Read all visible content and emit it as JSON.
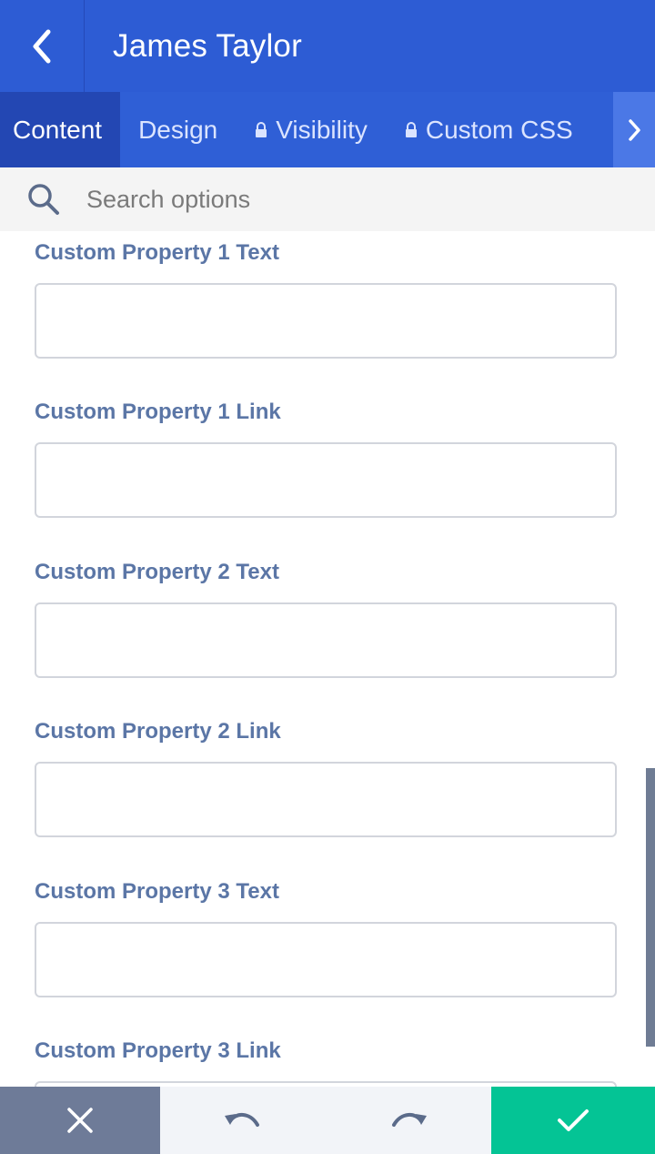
{
  "header": {
    "title": "James Taylor",
    "back_icon": "chevron-left-icon"
  },
  "tabs": [
    {
      "label": "Content",
      "active": true,
      "locked": false
    },
    {
      "label": "Design",
      "active": false,
      "locked": false
    },
    {
      "label": "Visibility",
      "active": false,
      "locked": true
    },
    {
      "label": "Custom CSS",
      "active": false,
      "locked": true
    }
  ],
  "search": {
    "placeholder": "Search options",
    "value": ""
  },
  "fields": [
    {
      "label": "Custom Property 1 Text",
      "value": ""
    },
    {
      "label": "Custom Property 1 Link",
      "value": ""
    },
    {
      "label": "Custom Property 2 Text",
      "value": ""
    },
    {
      "label": "Custom Property 2 Link",
      "value": ""
    },
    {
      "label": "Custom Property 3 Text",
      "value": ""
    },
    {
      "label": "Custom Property 3 Link",
      "value": ""
    }
  ],
  "footer": {
    "cancel_icon": "close-icon",
    "undo_icon": "undo-icon",
    "redo_icon": "redo-icon",
    "save_icon": "check-icon"
  },
  "colors": {
    "header_bg": "#2d5cd4",
    "tab_active_bg": "#2347b3",
    "label_color": "#5b76a6",
    "save_bg": "#04c495",
    "cancel_bg": "#6e7b98"
  }
}
